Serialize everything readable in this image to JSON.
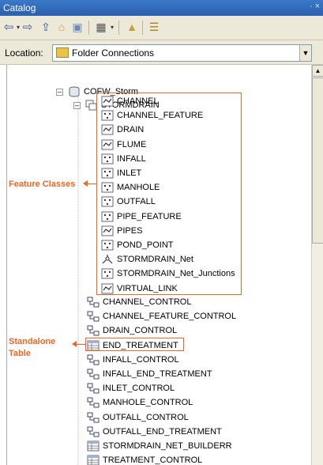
{
  "window": {
    "title": "Catalog",
    "pin_glyph": "∙ ×"
  },
  "location": {
    "label": "Location:",
    "value": "Folder Connections"
  },
  "tree": {
    "database": {
      "label": "COFW_Storm",
      "expander": "–"
    },
    "dataset": {
      "label": "STORMDRAIN",
      "expander": "–"
    },
    "feature_classes": [
      {
        "label": "CHANNEL",
        "icon": "line"
      },
      {
        "label": "CHANNEL_FEATURE",
        "icon": "point"
      },
      {
        "label": "DRAIN",
        "icon": "line"
      },
      {
        "label": "FLUME",
        "icon": "line"
      },
      {
        "label": "INFALL",
        "icon": "point"
      },
      {
        "label": "INLET",
        "icon": "point"
      },
      {
        "label": "MANHOLE",
        "icon": "point"
      },
      {
        "label": "OUTFALL",
        "icon": "point"
      },
      {
        "label": "PIPE_FEATURE",
        "icon": "point"
      },
      {
        "label": "PIPES",
        "icon": "line"
      },
      {
        "label": "POND_POINT",
        "icon": "point"
      },
      {
        "label": "STORMDRAIN_Net",
        "icon": "network"
      },
      {
        "label": "STORMDRAIN_Net_Junctions",
        "icon": "point"
      },
      {
        "label": "VIRTUAL_LINK",
        "icon": "line"
      }
    ],
    "other_items": [
      {
        "label": "CHANNEL_CONTROL",
        "icon": "relationship"
      },
      {
        "label": "CHANNEL_FEATURE_CONTROL",
        "icon": "relationship"
      },
      {
        "label": "DRAIN_CONTROL",
        "icon": "relationship"
      },
      {
        "label": "END_TREATMENT",
        "icon": "table"
      },
      {
        "label": "INFALL_CONTROL",
        "icon": "relationship"
      },
      {
        "label": "INFALL_END_TREATMENT",
        "icon": "relationship"
      },
      {
        "label": "INLET_CONTROL",
        "icon": "relationship"
      },
      {
        "label": "MANHOLE_CONTROL",
        "icon": "relationship"
      },
      {
        "label": "OUTFALL_CONTROL",
        "icon": "relationship"
      },
      {
        "label": "OUTFALL_END_TREATMENT",
        "icon": "relationship"
      },
      {
        "label": "STORMDRAIN_NET_BUILDERR",
        "icon": "table"
      },
      {
        "label": "TREATMENT_CONTROL",
        "icon": "table"
      }
    ]
  },
  "annotations": {
    "feature_classes": "Feature Classes",
    "standalone_table_line1": "Standalone",
    "standalone_table_line2": "Table",
    "accent_color": "#f26522"
  }
}
